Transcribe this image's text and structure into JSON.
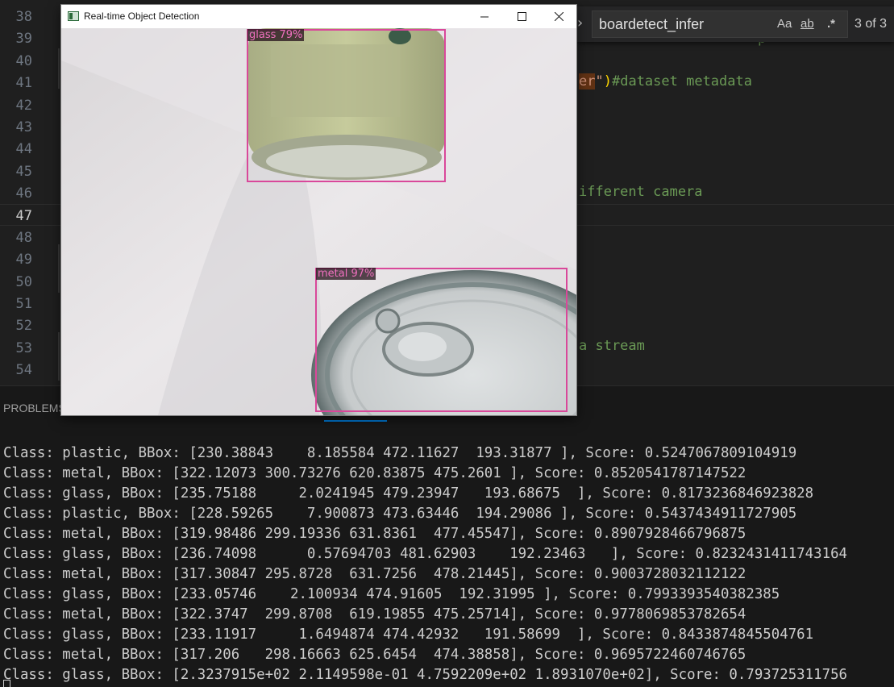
{
  "editor": {
    "line_numbers": [
      "38",
      "39",
      "40",
      "41",
      "42",
      "43",
      "44",
      "45",
      "46",
      "47",
      "48",
      "49",
      "50",
      "51",
      "52",
      "53",
      "54"
    ],
    "active_line": "47",
    "visible_code": {
      "line39_tail": "p",
      "line41_highlight": "er",
      "line41_quote": "\"",
      "line41_paren": ")",
      "line41_comment": "#dataset metadata",
      "line46_comment": "ifferent camera",
      "line53_comment": "a stream"
    }
  },
  "find_widget": {
    "query": "boardetect_infer",
    "match_case_label": "Aa",
    "whole_word_label": "ab",
    "regex_label": ".*",
    "match_count": "3 of 3"
  },
  "panel": {
    "tab_label": "PROBLEMS",
    "terminal_lines": [
      "Class: plastic, BBox: [230.38843    8.185584 472.11627  193.31877 ], Score: 0.5247067809104919",
      "Class: metal, BBox: [322.12073 300.73276 620.83875 475.2601 ], Score: 0.8520541787147522",
      "Class: glass, BBox: [235.75188     2.0241945 479.23947   193.68675  ], Score: 0.8173236846923828",
      "Class: plastic, BBox: [228.59265    7.900873 473.63446  194.29086 ], Score: 0.5437434911727905",
      "Class: metal, BBox: [319.98486 299.19336 631.8361  477.45547], Score: 0.8907928466796875",
      "Class: glass, BBox: [236.74098      0.57694703 481.62903    192.23463   ], Score: 0.8232431411743164",
      "Class: metal, BBox: [317.30847 295.8728  631.7256  478.21445], Score: 0.9003728032112122",
      "Class: glass, BBox: [233.05746    2.100934 474.91605  192.31995 ], Score: 0.7993393540382385",
      "Class: metal, BBox: [322.3747  299.8708  619.19855 475.25714], Score: 0.9778069853782654",
      "Class: glass, BBox: [233.11917     1.6494874 474.42932   191.58699  ], Score: 0.8433874845504761",
      "Class: metal, BBox: [317.206   298.16663 625.6454  474.38858], Score: 0.9695722460746765",
      "Class: glass, BBox: [2.3237915e+02 2.1149598e-01 4.7592209e+02 1.8931070e+02], Score: 0.793725311756"
    ]
  },
  "detection_window": {
    "title": "Real-time Object Detection",
    "detections": [
      {
        "label": "glass 79%"
      },
      {
        "label": "metal 97%"
      }
    ]
  }
}
